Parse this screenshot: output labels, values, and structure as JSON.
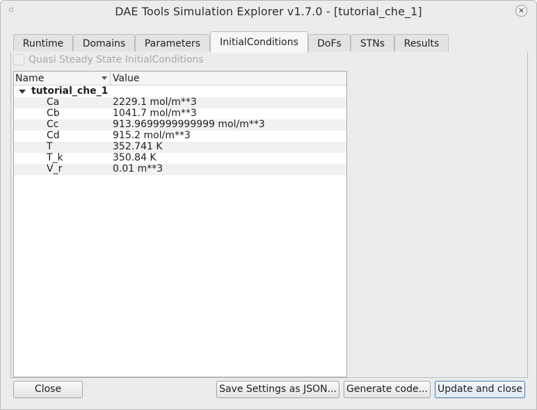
{
  "window": {
    "title": "DAE Tools Simulation Explorer v1.7.0 - [tutorial_che_1]",
    "close_glyph": "✕"
  },
  "tabs": [
    {
      "label": "Runtime",
      "active": false
    },
    {
      "label": "Domains",
      "active": false
    },
    {
      "label": "Parameters",
      "active": false
    },
    {
      "label": "InitialConditions",
      "active": true
    },
    {
      "label": "DoFs",
      "active": false
    },
    {
      "label": "STNs",
      "active": false
    },
    {
      "label": "Results",
      "active": false
    }
  ],
  "quasi_steady_state": {
    "label": "Quasi Steady State InitialConditions",
    "checked": false,
    "enabled": false
  },
  "tree": {
    "columns": {
      "name": "Name",
      "value": "Value"
    },
    "root": "tutorial_che_1",
    "rows": [
      {
        "name": "Ca",
        "value": "2229.1 mol/m**3"
      },
      {
        "name": "Cb",
        "value": "1041.7 mol/m**3"
      },
      {
        "name": "Cc",
        "value": "913.9699999999999 mol/m**3"
      },
      {
        "name": "Cd",
        "value": "915.2 mol/m**3"
      },
      {
        "name": "T",
        "value": "352.741 K"
      },
      {
        "name": "T_k",
        "value": "350.84 K"
      },
      {
        "name": "V_r",
        "value": "0.01 m**3"
      }
    ]
  },
  "buttons": {
    "close": "Close",
    "save_settings": "Save Settings as JSON...",
    "generate_code": "Generate code...",
    "update_and_close": "Update and close"
  },
  "colors": {
    "window_bg": "#ececec",
    "default_button_border": "#3d78b5",
    "alt_row": "#f1f1f1"
  }
}
